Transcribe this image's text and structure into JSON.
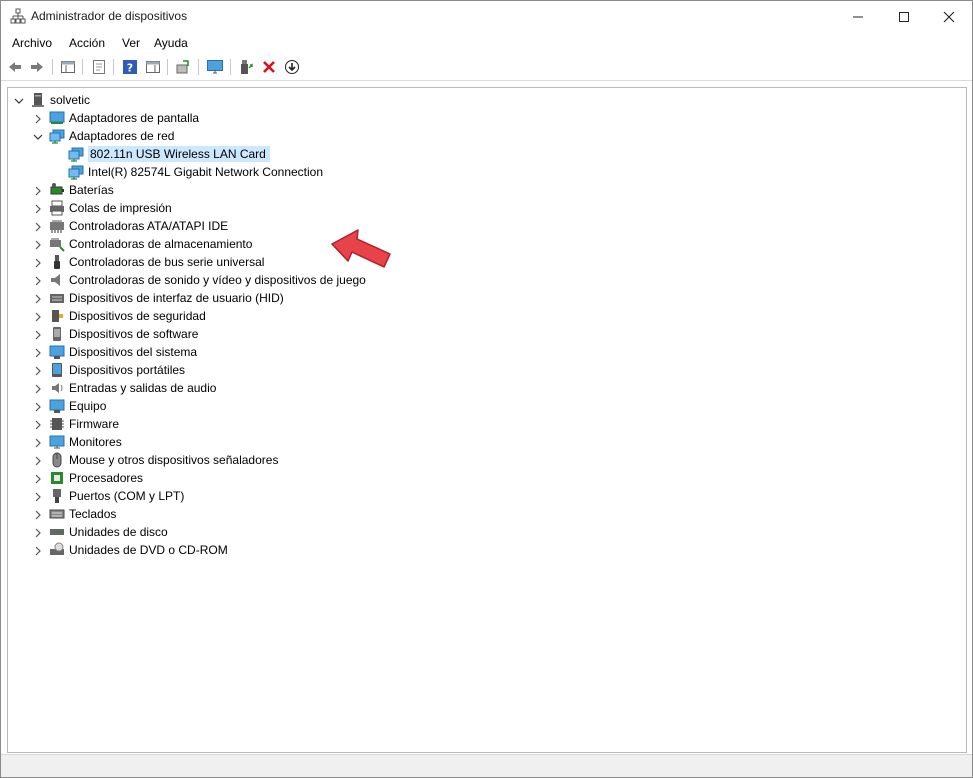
{
  "window": {
    "title": "Administrador de dispositivos"
  },
  "menu": {
    "items": [
      "Archivo",
      "Acción",
      "Ver",
      "Ayuda"
    ]
  },
  "tree": {
    "root": "solvetic",
    "adapters_display": "Adaptadores de pantalla",
    "adapters_network": "Adaptadores de red",
    "net_children": [
      "802.11n USB Wireless LAN Card",
      "Intel(R) 82574L Gigabit Network Connection"
    ],
    "categories": [
      "Baterías",
      "Colas de impresión",
      "Controladoras ATA/ATAPI IDE",
      "Controladoras de almacenamiento",
      "Controladoras de bus serie universal",
      "Controladoras de sonido y vídeo y dispositivos de juego",
      "Dispositivos de interfaz de usuario (HID)",
      "Dispositivos de seguridad",
      "Dispositivos de software",
      "Dispositivos del sistema",
      "Dispositivos portátiles",
      "Entradas y salidas de audio",
      "Equipo",
      "Firmware",
      "Monitores",
      "Mouse y otros dispositivos señaladores",
      "Procesadores",
      "Puertos (COM y LPT)",
      "Teclados",
      "Unidades de disco",
      "Unidades de DVD o CD-ROM"
    ]
  },
  "colors": {
    "selection": "#cce8ff",
    "accent_arrow": "#e8434b",
    "net_icon": "#3a8fd6"
  },
  "icons": {
    "categories": [
      "battery-icon",
      "printer-icon",
      "ide-controller-icon",
      "storage-controller-icon",
      "usb-icon",
      "sound-icon",
      "hid-icon",
      "security-icon",
      "software-device-icon",
      "system-device-icon",
      "portable-device-icon",
      "audio-io-icon",
      "computer-icon",
      "firmware-icon",
      "monitor-icon",
      "mouse-icon",
      "processor-icon",
      "port-icon",
      "keyboard-icon",
      "disk-drive-icon",
      "dvd-drive-icon"
    ]
  }
}
